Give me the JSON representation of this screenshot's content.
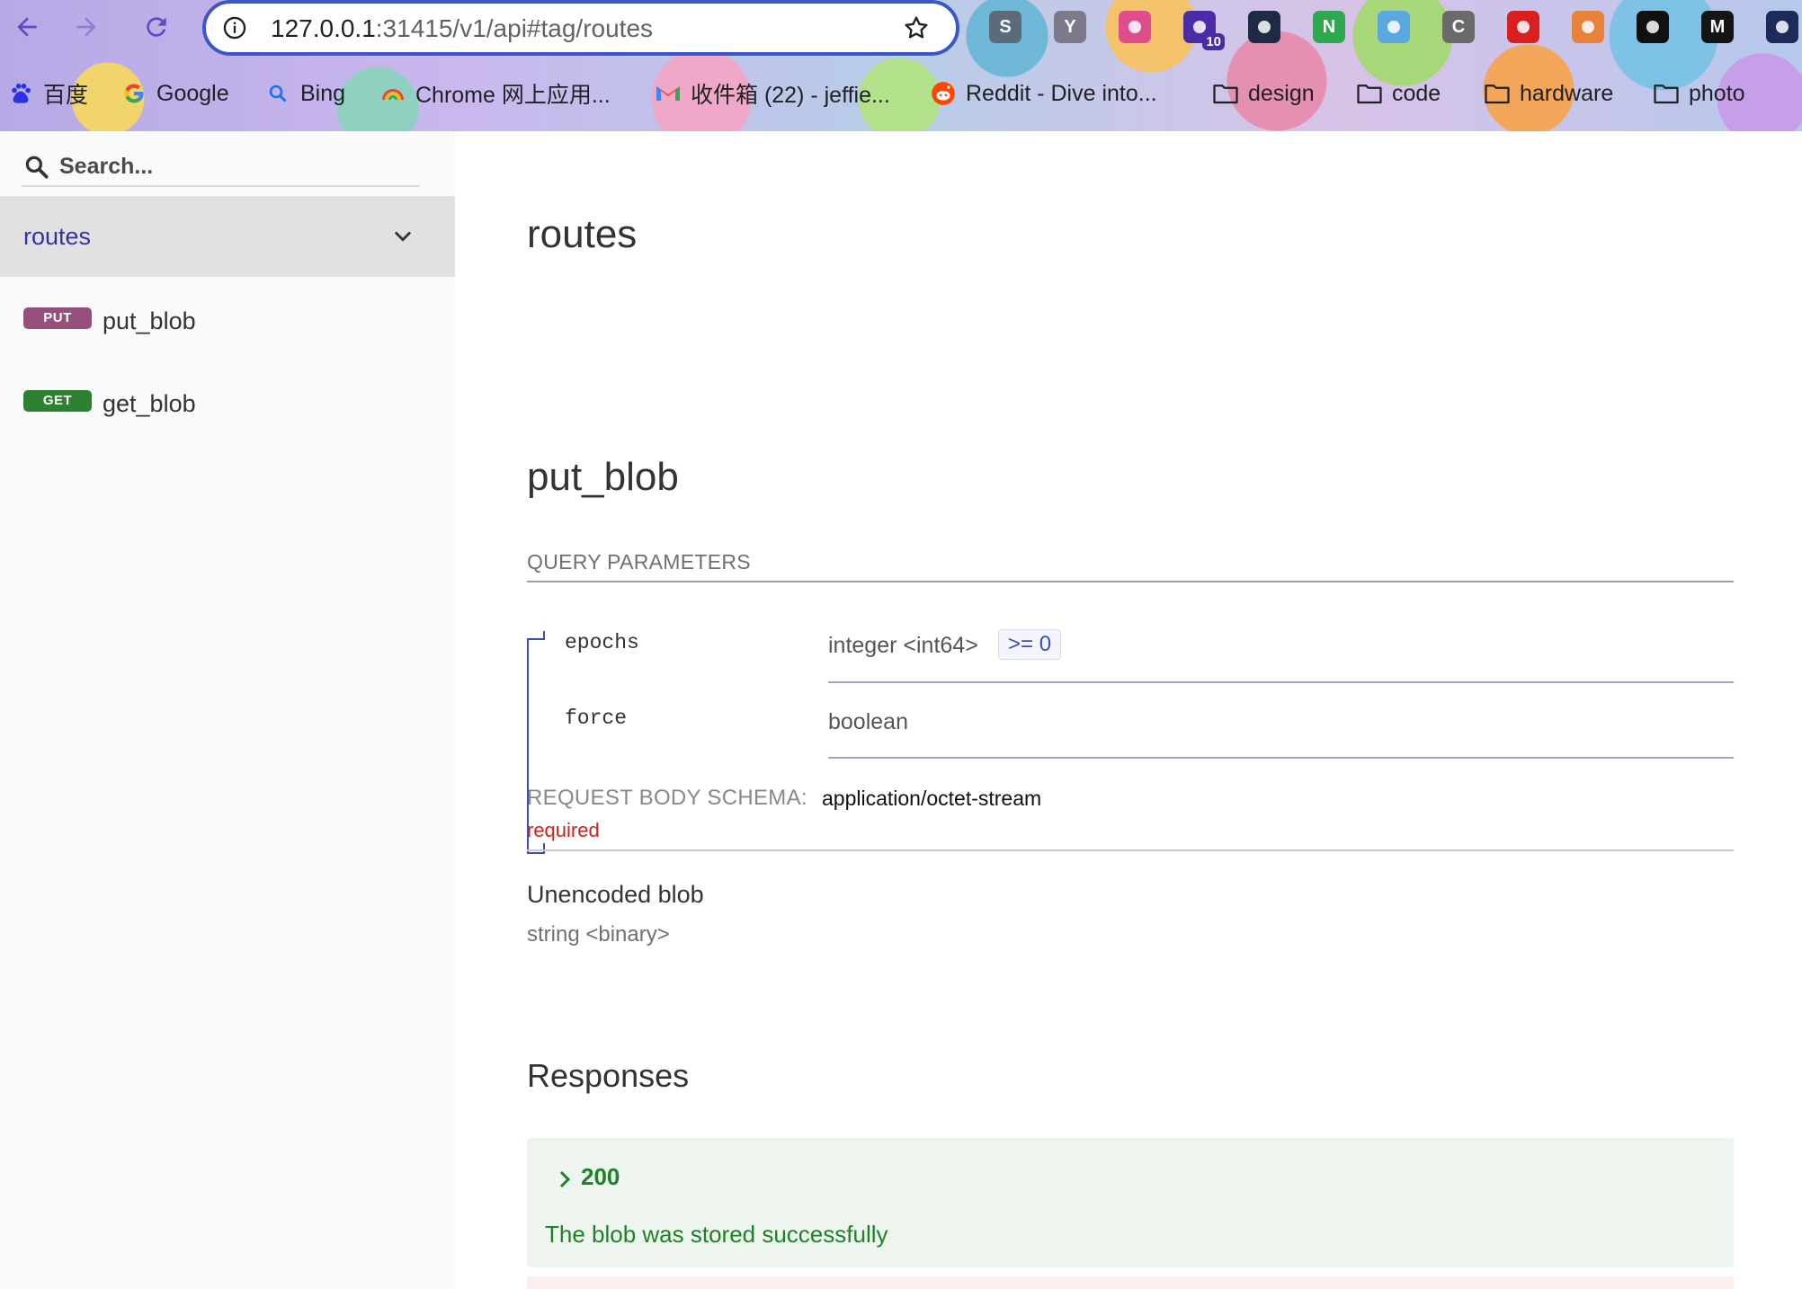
{
  "browser": {
    "url_host": "127.0.0.1",
    "url_rest": ":31415/v1/api#tag/routes",
    "extensions": [
      {
        "name": "s-icon",
        "letter": "S"
      },
      {
        "name": "y-icon",
        "letter": "Y"
      },
      {
        "name": "tv-icon",
        "letter": ""
      },
      {
        "name": "graduation-cap-icon",
        "letter": "",
        "badge": "10"
      },
      {
        "name": "react-icon",
        "letter": ""
      },
      {
        "name": "n-icon",
        "letter": "N"
      },
      {
        "name": "drop-icon",
        "letter": ""
      },
      {
        "name": "c-icon",
        "letter": "C"
      },
      {
        "name": "stop-hand-icon",
        "letter": ""
      },
      {
        "name": "fox-icon",
        "letter": ""
      },
      {
        "name": "dots-icon",
        "letter": ""
      },
      {
        "name": "m-icon",
        "letter": "M"
      },
      {
        "name": "fingerprint-icon",
        "letter": ""
      }
    ],
    "bookmarks": [
      {
        "name": "bookmark-baidu",
        "icon": "baidu-icon",
        "label": "百度"
      },
      {
        "name": "bookmark-google",
        "icon": "google-icon",
        "label": "Google"
      },
      {
        "name": "bookmark-bing",
        "icon": "search-icon",
        "label": "Bing"
      },
      {
        "name": "bookmark-chrome-store",
        "icon": "rainbow-icon",
        "label": "Chrome 网上应用..."
      },
      {
        "name": "bookmark-gmail",
        "icon": "gmail-icon",
        "label": "收件箱 (22) - jeffie..."
      },
      {
        "name": "bookmark-reddit",
        "icon": "reddit-icon",
        "label": "Reddit - Dive into..."
      },
      {
        "name": "bookmark-folder-design",
        "icon": "folder-icon",
        "label": "design"
      },
      {
        "name": "bookmark-folder-code",
        "icon": "folder-icon",
        "label": "code"
      },
      {
        "name": "bookmark-folder-hardware",
        "icon": "folder-icon",
        "label": "hardware"
      },
      {
        "name": "bookmark-folder-photo",
        "icon": "folder-icon",
        "label": "photo"
      }
    ]
  },
  "sidebar": {
    "search_placeholder": "Search...",
    "tag_label": "routes",
    "operations": [
      {
        "method": "PUT",
        "label": "put_blob"
      },
      {
        "method": "GET",
        "label": "get_blob"
      }
    ]
  },
  "main": {
    "tag_title": "routes",
    "operation_title": "put_blob",
    "query_parameters_header": "QUERY PARAMETERS",
    "params": [
      {
        "name": "epochs",
        "type": "integer <int64>",
        "constraint": ">= 0"
      },
      {
        "name": "force",
        "type": "boolean"
      }
    ],
    "request_body": {
      "label": "REQUEST BODY SCHEMA:",
      "content_type": "application/octet-stream",
      "required": "required",
      "description": "Unencoded blob",
      "format": "string <binary>"
    },
    "responses": {
      "title": "Responses",
      "items": [
        {
          "code": "200",
          "description": "The blob was stored successfully"
        }
      ]
    }
  },
  "colors": {
    "put": "#95507c",
    "get": "#2f8132",
    "link": "#32329f",
    "required": "#d41f1c",
    "success": "#1d8127"
  }
}
